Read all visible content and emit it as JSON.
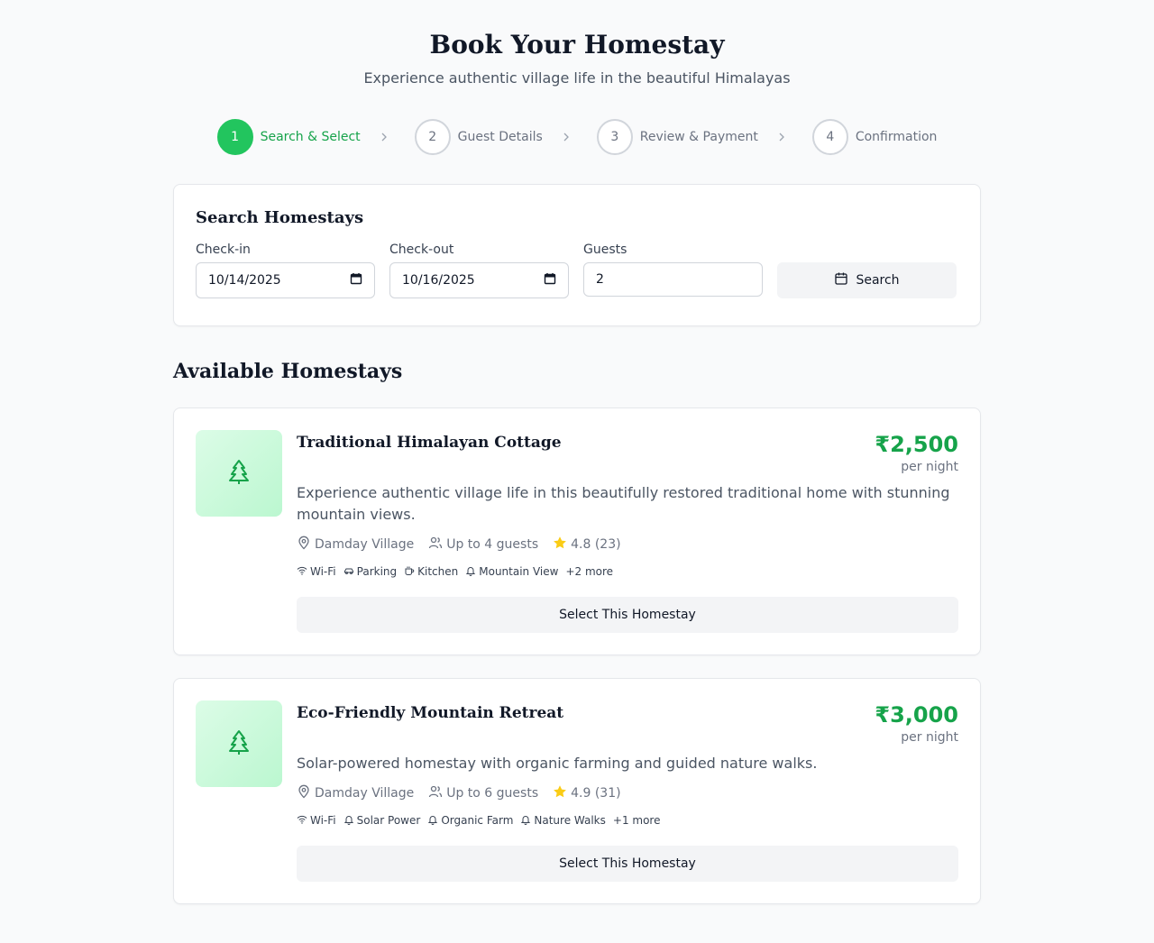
{
  "header": {
    "title": "Book Your Homestay",
    "subtitle": "Experience authentic village life in the beautiful Himalayas"
  },
  "steps": [
    {
      "num": "1",
      "label": "Search & Select",
      "active": true
    },
    {
      "num": "2",
      "label": "Guest Details",
      "active": false
    },
    {
      "num": "3",
      "label": "Review & Payment",
      "active": false
    },
    {
      "num": "4",
      "label": "Confirmation",
      "active": false
    }
  ],
  "search": {
    "title": "Search Homestays",
    "checkin_label": "Check-in",
    "checkin_value": "10/14/2025",
    "checkout_label": "Check-out",
    "checkout_value": "10/16/2025",
    "guests_label": "Guests",
    "guests_value": "2",
    "button_label": "Search"
  },
  "available_title": "Available Homestays",
  "homestays": [
    {
      "name": "Traditional Himalayan Cottage",
      "price": "₹2,500",
      "price_unit": "per night",
      "description": "Experience authentic village life in this beautifully restored traditional home with stunning mountain views.",
      "location": "Damday Village",
      "capacity": "Up to 4 guests",
      "rating": "4.8 (23)",
      "amenities": [
        "Wi-Fi",
        "Parking",
        "Kitchen",
        "Mountain View"
      ],
      "amenity_icons": [
        "wifi-icon",
        "car-icon",
        "coffee-icon",
        "bell-icon"
      ],
      "more": "+2 more",
      "select_label": "Select This Homestay"
    },
    {
      "name": "Eco-Friendly Mountain Retreat",
      "price": "₹3,000",
      "price_unit": "per night",
      "description": "Solar-powered homestay with organic farming and guided nature walks.",
      "location": "Damday Village",
      "capacity": "Up to 6 guests",
      "rating": "4.9 (31)",
      "amenities": [
        "Wi-Fi",
        "Solar Power",
        "Organic Farm",
        "Nature Walks"
      ],
      "amenity_icons": [
        "wifi-icon",
        "bell-icon",
        "bell-icon",
        "bell-icon"
      ],
      "more": "+1 more",
      "select_label": "Select This Homestay"
    }
  ],
  "colors": {
    "accent": "#22c55e",
    "price": "#16a34a",
    "star": "#facc15"
  }
}
